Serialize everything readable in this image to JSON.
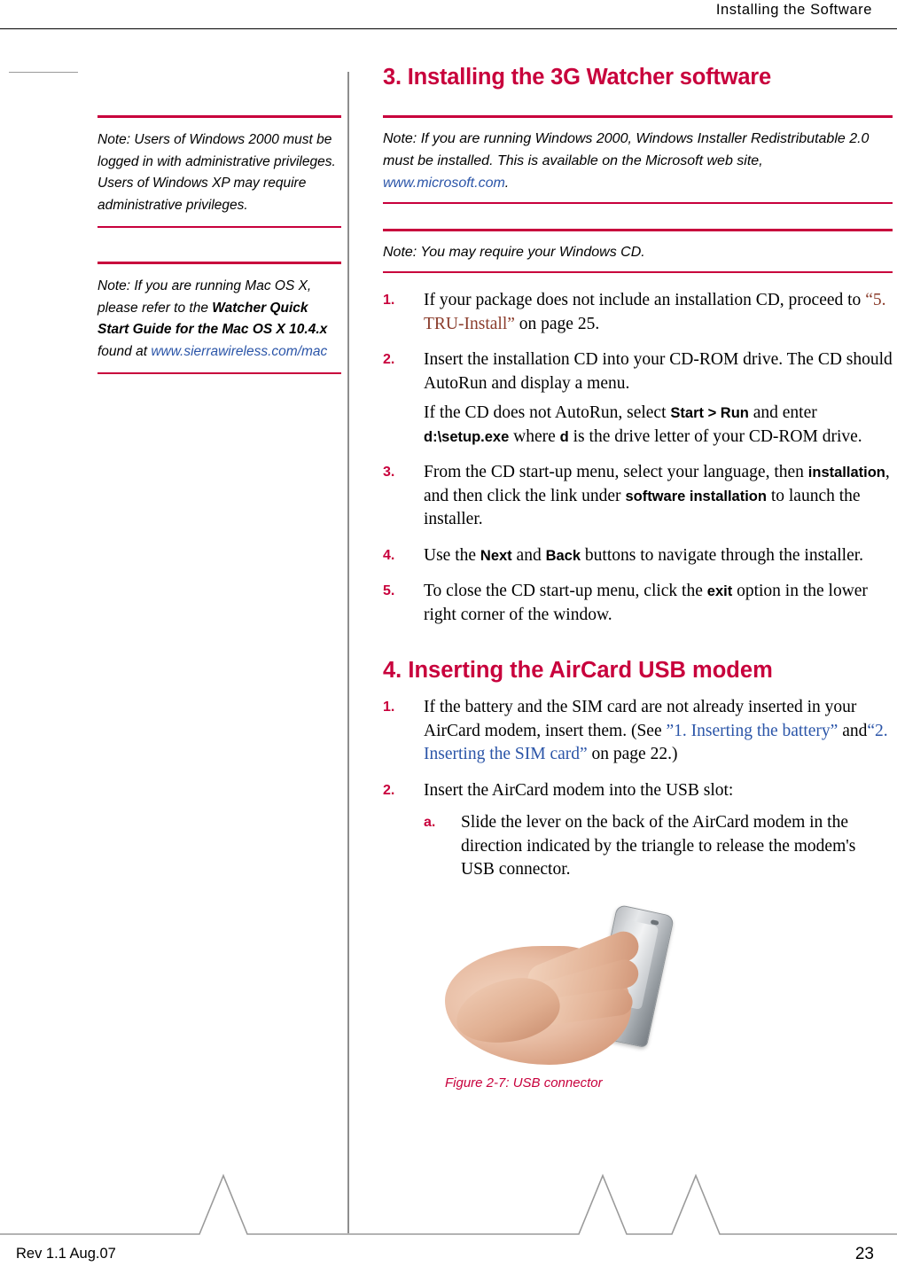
{
  "header": {
    "title": "Installing the Software"
  },
  "sidebar": {
    "notes": [
      {
        "label": "Note:",
        "text": " Users of Windows 2000 must be logged in with administrative privileges. Users of Windows XP may require administrative privileges."
      },
      {
        "label": "Note:",
        "text_pre": " If you are running Mac OS X, please refer to the ",
        "bold": "Watcher Quick Start Guide for the Mac OS X 10.4.x",
        "text_mid": " found at ",
        "link": "www.sierrawireless.com/mac"
      }
    ]
  },
  "main": {
    "section3": {
      "number": "3.",
      "title": "Installing the 3G Watcher software"
    },
    "notes": [
      {
        "label": "Note:",
        "text_pre": " If you are running Windows 2000, Windows Installer Redistributable 2.0 must be installed. This is available on the Microsoft web site, ",
        "link": "www.microsoft.com",
        "text_post": "."
      },
      {
        "label": "Note:",
        "text_pre": " You may require your Windows CD."
      }
    ],
    "steps3": [
      {
        "num": "1.",
        "parts": [
          {
            "t": "If your package does not include an installation CD, proceed to ",
            "s": "plain"
          },
          {
            "t": "“5. TRU-Install”",
            "s": "xref"
          },
          {
            "t": " on page 25.",
            "s": "plain"
          }
        ]
      },
      {
        "num": "2.",
        "parts": [
          {
            "t": "Insert the installation CD into your CD-ROM drive. The CD should AutoRun and display a menu.",
            "s": "plain"
          }
        ],
        "sub_paragraph": [
          {
            "t": "If the CD does not AutoRun, select ",
            "s": "plain"
          },
          {
            "t": "Start > Run",
            "s": "ui"
          },
          {
            "t": " and enter ",
            "s": "plain"
          },
          {
            "t": "d:\\setup.exe",
            "s": "ui"
          },
          {
            "t": " where ",
            "s": "plain"
          },
          {
            "t": "d",
            "s": "ui"
          },
          {
            "t": " is the drive letter of your CD-ROM drive.",
            "s": "plain"
          }
        ]
      },
      {
        "num": "3.",
        "parts": [
          {
            "t": "From the CD start-up menu, select your language, then ",
            "s": "plain"
          },
          {
            "t": "installation",
            "s": "ui"
          },
          {
            "t": ", and then click the link under ",
            "s": "plain"
          },
          {
            "t": "software installation",
            "s": "ui"
          },
          {
            "t": " to launch the installer.",
            "s": "plain"
          }
        ]
      },
      {
        "num": "4.",
        "parts": [
          {
            "t": "Use the ",
            "s": "plain"
          },
          {
            "t": "Next",
            "s": "ui"
          },
          {
            "t": " and ",
            "s": "plain"
          },
          {
            "t": "Back",
            "s": "ui"
          },
          {
            "t": " buttons to navigate through the installer.",
            "s": "plain"
          }
        ]
      },
      {
        "num": "5.",
        "parts": [
          {
            "t": "To close the CD start-up menu, click the ",
            "s": "plain"
          },
          {
            "t": "exit",
            "s": "ui"
          },
          {
            "t": " option in the lower right corner of the window.",
            "s": "plain"
          }
        ]
      }
    ],
    "section4": {
      "number": "4.",
      "title": "Inserting the AirCard USB modem"
    },
    "steps4": [
      {
        "num": "1.",
        "parts": [
          {
            "t": "If the battery and the SIM card are not already inserted in your AirCard modem, insert them. (See ",
            "s": "plain"
          },
          {
            "t": "”1. Inserting the battery”",
            "s": "xref-blue"
          },
          {
            "t": " and",
            "s": "plain"
          },
          {
            "t": "“2. Inserting the SIM card”",
            "s": "xref-blue"
          },
          {
            "t": " on page 22.)",
            "s": "plain"
          }
        ]
      },
      {
        "num": "2.",
        "parts": [
          {
            "t": "Insert the AirCard modem into the USB slot:",
            "s": "plain"
          }
        ],
        "substeps": [
          {
            "num": "a.",
            "parts": [
              {
                "t": "Slide the lever on the back of the AirCard modem in the direction indicated by the triangle to release the modem's USB connector.",
                "s": "plain"
              }
            ]
          }
        ]
      }
    ],
    "figure": {
      "caption": "Figure 2-7:  USB connector"
    }
  },
  "footer": {
    "revision": "Rev 1.1  Aug.07",
    "page_number": "23"
  },
  "colors": {
    "accent_red": "#c8003c",
    "link_blue": "#2b55a8",
    "xref_brown": "#8a3b2a"
  }
}
